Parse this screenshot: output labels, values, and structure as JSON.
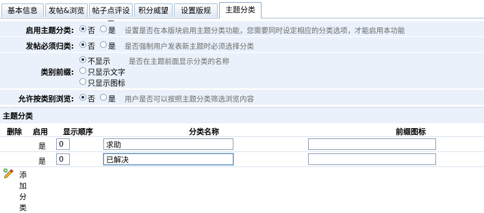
{
  "tabs": [
    {
      "label": "基本信息",
      "active": false
    },
    {
      "label": "发帖&浏览",
      "active": false
    },
    {
      "label": "帖子点评设置",
      "active": false
    },
    {
      "label": "积分威望",
      "active": false
    },
    {
      "label": "设置版规",
      "active": false
    },
    {
      "label": "主题分类",
      "active": true
    }
  ],
  "settings": {
    "enable": {
      "label": "启用主题分类:",
      "options": [
        "否",
        "是"
      ],
      "selected": "否",
      "hint": "设置是否在本版块启用主题分类功能，您需要同时设定相应的分类选项，才能启用本功能"
    },
    "required": {
      "label": "发帖必须归类:",
      "options": [
        "否",
        "是"
      ],
      "selected": "否",
      "hint": "是否强制用户发表新主题时必须选择分类"
    },
    "prefix": {
      "label": "类别前缀:",
      "options": [
        "不显示",
        "只显示文字",
        "只显示图标"
      ],
      "selected": "不显示",
      "hint": "是否在主题前面显示分类的名称"
    },
    "browse": {
      "label": "允许按类别浏览:",
      "options": [
        "否",
        "是"
      ],
      "selected": "否",
      "hint": "用户是否可以按照主题分类筛选浏览内容"
    }
  },
  "categories": {
    "title": "主题分类",
    "headers": {
      "delete": "删除",
      "enable": "启用",
      "order": "显示顺序",
      "name": "分类名称",
      "icon": "前缀图标"
    },
    "rows": [
      {
        "enabled": "是",
        "order": "0",
        "name": "求助",
        "icon": ""
      },
      {
        "enabled": "是",
        "order": "0",
        "name": "已解决",
        "icon": ""
      }
    ],
    "add_label": "添加分类"
  },
  "colors": {
    "row_bg": "#eaf1fa",
    "border": "#a9bfd6",
    "hint_text": "#6b6b6b"
  }
}
